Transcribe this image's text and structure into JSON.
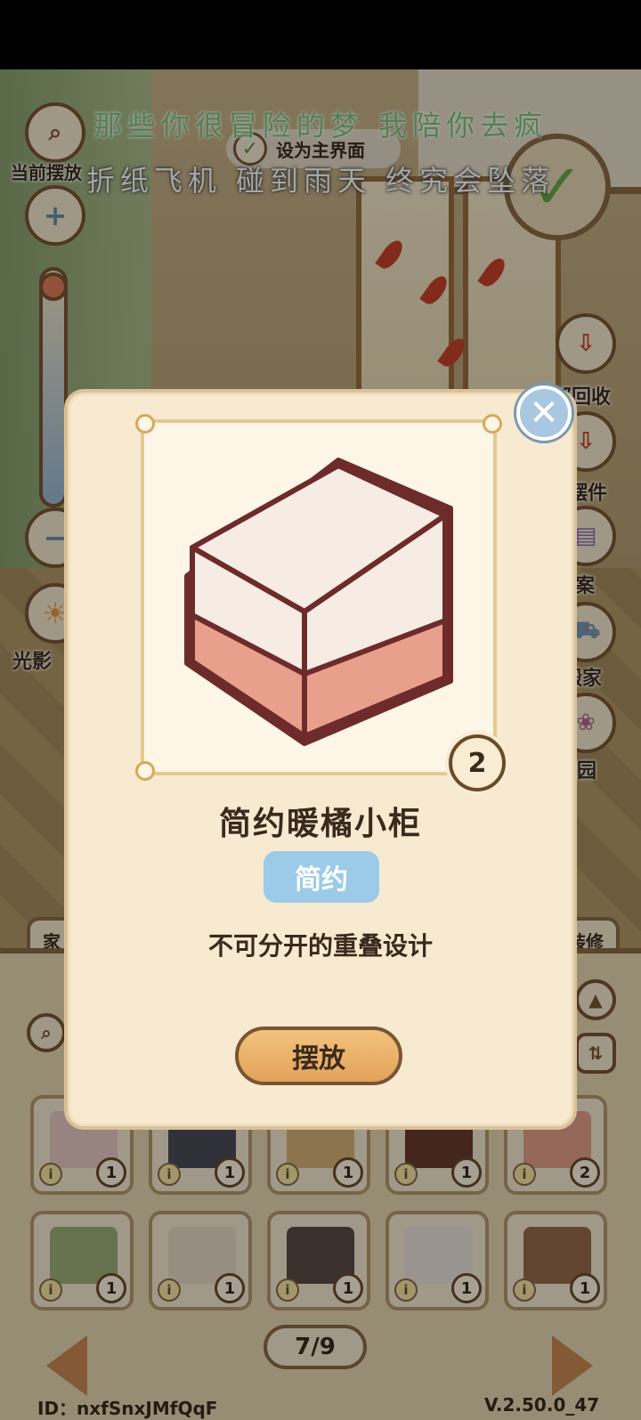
{
  "overlay": {
    "lyric_line1": "那些你很冒险的梦 我陪你去疯",
    "lyric_line2": "折纸飞机 碰到雨天 终究会坠落"
  },
  "top_controls": {
    "set_main_label": "设为主界面",
    "current_label": "当前摆放",
    "confirm_icon": "check-icon"
  },
  "left_controls": {
    "zoom_in_icon": "plus-icon",
    "zoom_out_icon": "minus-icon",
    "light_label": "光影"
  },
  "right_controls": [
    {
      "label": "全部回收",
      "icon": "recycle-box-icon"
    },
    {
      "label": "收摆件",
      "icon": "collect-box-icon"
    },
    {
      "label": "方案",
      "icon": "plan-icon"
    },
    {
      "label": "搬家",
      "icon": "truck-icon"
    },
    {
      "label": "花园",
      "icon": "garden-icon"
    }
  ],
  "inventory": {
    "tabs": [
      "家",
      "装修"
    ],
    "items": [
      {
        "count": "1",
        "color": "#e8c9c4"
      },
      {
        "count": "1",
        "color": "#4a4a58"
      },
      {
        "count": "1",
        "color": "#d8b27a"
      },
      {
        "count": "1",
        "color": "#6b3b2e"
      },
      {
        "count": "2",
        "color": "#e5a08a"
      },
      {
        "count": "1",
        "color": "#9fb07a"
      },
      {
        "count": "1",
        "color": "#e6dcc6"
      },
      {
        "count": "1",
        "color": "#5a4a44"
      },
      {
        "count": "1",
        "color": "#ece3dc"
      },
      {
        "count": "1",
        "color": "#9a6a4e"
      }
    ],
    "page": "7/9"
  },
  "footer": {
    "user_id": "ID：nxfSnxJMfQqF",
    "version": "V.2.50.0_47"
  },
  "modal": {
    "item_name": "简约暖橘小柜",
    "style_tag": "简约",
    "description": "不可分开的重叠设计",
    "owned_count": "2",
    "place_button": "摆放",
    "colors": {
      "top": "#f6ece4",
      "bottom": "#e8a08c",
      "outline": "#6e2b2b",
      "tag": "#9ccbe9"
    }
  }
}
